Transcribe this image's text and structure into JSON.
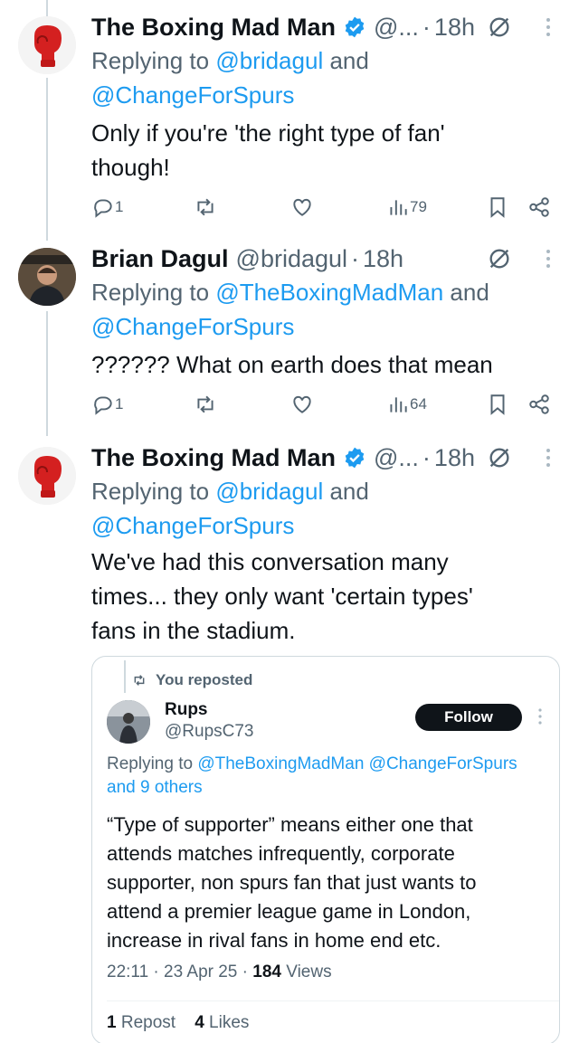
{
  "tweets": [
    {
      "name": "The Boxing Mad Man",
      "handle": "@...",
      "dot": "·",
      "time": "18h",
      "replying_prefix": "Replying to ",
      "replying_line1_mention": "@bridagul",
      "replying_line1_suffix": " and",
      "replying_line2_mention": "@ChangeForSpurs",
      "body_lines": [
        "Only if you're 'the right type of fan'",
        "though!"
      ],
      "replies": "1",
      "views": "79",
      "avatar": "boxing-glove"
    },
    {
      "name": "Brian Dagul",
      "handle": "@bridagul",
      "dot": "·",
      "time": "18h",
      "replying_prefix": "Replying to ",
      "replying_line1_mention": "@TheBoxingMadMan",
      "replying_line1_suffix": " and",
      "replying_line2_mention": "@ChangeForSpurs",
      "body_lines": [
        "?????? What on earth does that mean"
      ],
      "replies": "1",
      "views": "64",
      "avatar": "photo"
    },
    {
      "name": "The Boxing Mad Man",
      "handle": "@...",
      "dot": "·",
      "time": "18h",
      "replying_prefix": "Replying to ",
      "replying_line1_mention": "@bridagul",
      "replying_line1_suffix": " and",
      "replying_line2_mention": "@ChangeForSpurs",
      "body_lines": [
        "We've had this conversation many",
        "times... they only want 'certain types'",
        "fans in the stadium."
      ],
      "avatar": "boxing-glove"
    }
  ],
  "quote": {
    "reposted_label": "You reposted",
    "name": "Rups",
    "handle": "@RupsC73",
    "follow_label": "Follow",
    "replying_prefix": "Replying to ",
    "replying_mentions": "@TheBoxingMadMan @ChangeForSpurs",
    "replying_others": "and 9 others",
    "text_lines": [
      "“Type of supporter” means either one that",
      "attends matches infrequently, corporate",
      "supporter, non spurs fan that just wants to",
      "attend a premier league game in London,",
      "increase in rival fans in home end etc."
    ],
    "time": "22:11",
    "date": "23 Apr 25",
    "views_count": "184",
    "views_label": " Views",
    "sep": " · ",
    "reposts_count": "1",
    "reposts_label": " Repost",
    "likes_count": "4",
    "likes_label": " Likes"
  },
  "colors": {
    "accent": "#1d9bf0",
    "text": "#0f1419",
    "muted": "#536471",
    "glove_red": "#d42020"
  },
  "icons": [
    "verified-badge-icon",
    "no-reply-icon",
    "more-icon",
    "reply-icon",
    "retweet-icon",
    "like-icon",
    "views-icon",
    "bookmark-icon",
    "share-icon"
  ]
}
